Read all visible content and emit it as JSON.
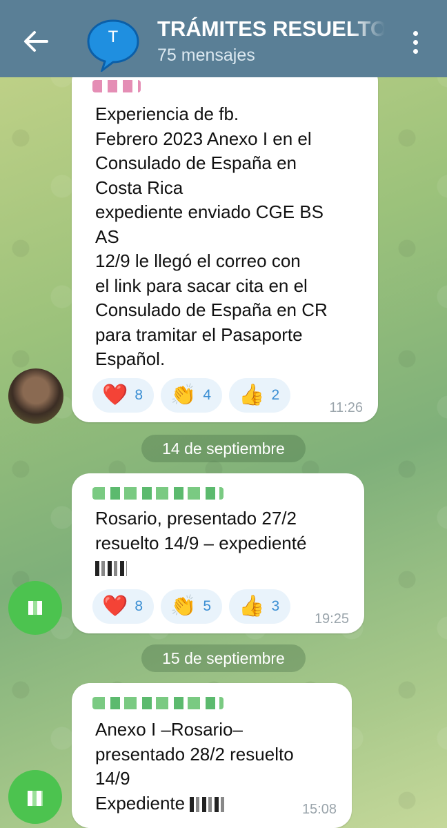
{
  "header": {
    "title": "TRÁMITES RESUELTOS",
    "subtitle": "75 mensajes",
    "avatar_letter": "T",
    "back_icon": "arrow-left-icon",
    "menu_icon": "more-vertical-icon"
  },
  "messages": [
    {
      "lines": [
        "Experiencia de fb.",
        "Febrero 2023 Anexo I en el",
        "Consulado de España en",
        "Costa Rica",
        "expediente enviado CGE BS",
        "AS",
        "12/9 le llegó el correo con",
        "el link para sacar cita en el",
        "Consulado de España en CR",
        "para tramitar el Pasaporte",
        "Español."
      ],
      "time": "11:26",
      "reactions": [
        {
          "emoji": "❤️",
          "count": "8"
        },
        {
          "emoji": "👏",
          "count": "4"
        },
        {
          "emoji": "👍",
          "count": "2"
        }
      ]
    },
    {
      "lines": [
        "Rosario, presentado 27/2",
        "resuelto 14/9 – expedienté"
      ],
      "time": "19:25",
      "reactions": [
        {
          "emoji": "❤️",
          "count": "8"
        },
        {
          "emoji": "👏",
          "count": "5"
        },
        {
          "emoji": "👍",
          "count": "3"
        }
      ]
    },
    {
      "lines": [
        "Anexo I –Rosario–",
        "presentado 28/2 resuelto",
        "14/9",
        "Expediente"
      ],
      "time": "15:08"
    }
  ],
  "dates": [
    "14 de septiembre",
    "15 de septiembre"
  ],
  "colors": {
    "header": "#5a7f96",
    "reaction_bg": "#e9f3fb",
    "reaction_count": "#3a8ed3",
    "avatar_green": "#4cc34f"
  }
}
